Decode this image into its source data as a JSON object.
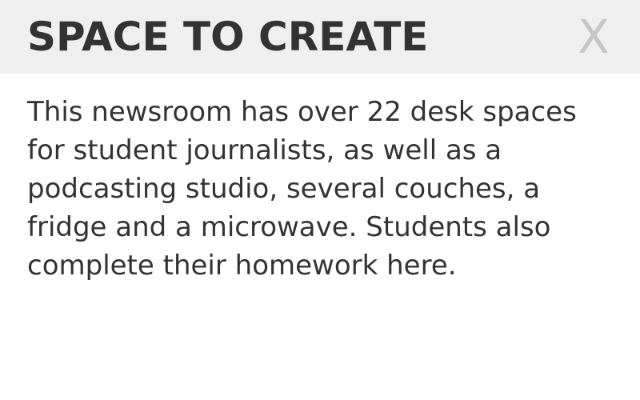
{
  "dialog": {
    "title": "SPACE TO CREATE",
    "close_label": "X",
    "body": "This newsroom has over 22 desk spaces for student journalists, as well as a podcasting studio, several couches, a fridge and a microwave. Students also complete their homework here."
  },
  "colors": {
    "header_background": "#efefef",
    "text": "#333333",
    "close_icon": "#c5c5c5",
    "background": "#ffffff"
  }
}
